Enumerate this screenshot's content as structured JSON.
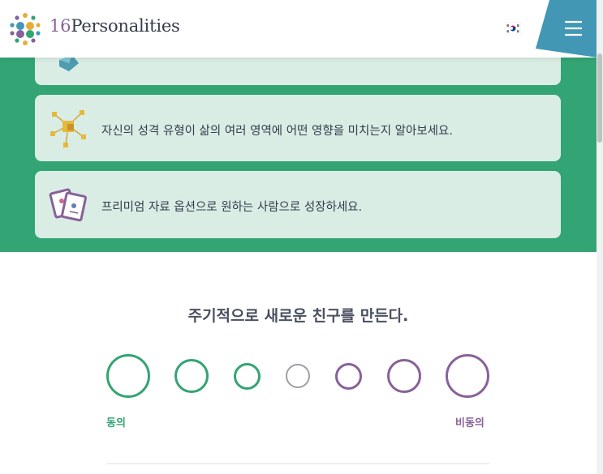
{
  "header": {
    "logo_number": "16",
    "logo_word": "Personalities",
    "language_flag": "korea-flag-icon",
    "menu_icon": "hamburger-menu-icon"
  },
  "cards": [
    {
      "text": "자신의 성격 유형이 삶의 여러 영역에 어떤 영향을 미치는지 알아보세요.",
      "icon": "network-cubes-icon"
    },
    {
      "text": "프리미엄 자료 옵션으로 원하는 사람으로 성장하세요.",
      "icon": "cards-icon"
    }
  ],
  "question": {
    "text": "주기적으로 새로운 친구를 만든다.",
    "agree_label": "동의",
    "disagree_label": "비동의",
    "option_count": 7
  },
  "colors": {
    "green": "#33a474",
    "purple": "#88619a",
    "neutral": "#9c9fa7",
    "card_bg": "#d9ede4",
    "menu_blue": "#4298b4"
  }
}
